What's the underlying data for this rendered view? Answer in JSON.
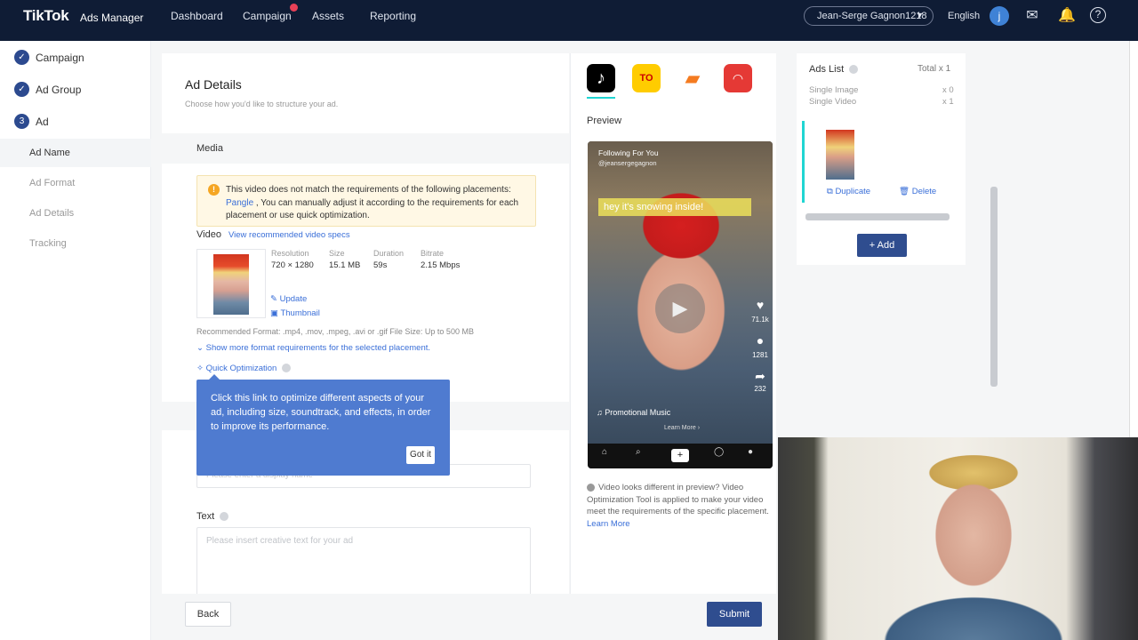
{
  "topbar": {
    "brand": "TikTok",
    "brand_sub": "Ads Manager",
    "nav": [
      "Dashboard",
      "Campaign",
      "Assets",
      "Reporting"
    ],
    "account": "Jean-Serge Gagnon1218",
    "language": "English",
    "avatar_letter": "j"
  },
  "sidebar": {
    "steps": [
      {
        "label": "Campaign",
        "mark": "✓"
      },
      {
        "label": "Ad Group",
        "mark": "✓"
      },
      {
        "label": "Ad",
        "mark": "3"
      }
    ],
    "substeps": [
      "Ad Name",
      "Ad Format",
      "Ad Details",
      "Tracking"
    ]
  },
  "ad_details": {
    "title": "Ad Details",
    "subtitle": "Choose how you'd like to structure your ad.",
    "media_section": "Media",
    "warning_pre": "This video does not match the requirements of the following placements: ",
    "warning_link": "Pangle",
    "warning_post": " , You can manually adjust it according to the requirements for each placement or use quick optimization.",
    "video_label": "Video",
    "video_specs_link": "View recommended video specs",
    "meta": {
      "resolution_h": "Resolution",
      "resolution": "720 × 1280",
      "size_h": "Size",
      "size": "15.1 MB",
      "duration_h": "Duration",
      "duration": "59s",
      "bitrate_h": "Bitrate",
      "bitrate": "2.15 Mbps"
    },
    "update": "Update",
    "thumbnail": "Thumbnail",
    "recommended_format": "Recommended Format: .mp4, .mov, .mpeg, .avi or .gif  File Size: Up to 500 MB",
    "show_more": "Show more format requirements for the selected placement.",
    "quick_opt": "Quick Optimization",
    "display_name_placeholder": "Please enter a display name",
    "text_label": "Text",
    "text_placeholder": "Please insert creative text for your ad"
  },
  "tooltip": {
    "text": "Click this link to optimize different aspects of your ad, including size, soundtrack, and effects, in order to improve its performance.",
    "button": "Got it"
  },
  "preview": {
    "label": "Preview",
    "topbar": "Following  For You",
    "handle": "@jeanserge​gagnon",
    "caption": "hey it's snowing inside!",
    "likes": "71.1k",
    "comments": "1281",
    "shares": "232",
    "music": "Promotional Music",
    "learn_more": "Learn More ›",
    "nav": [
      "Home",
      "Discover",
      "Notifications",
      "Me"
    ],
    "note": "Video looks different in preview? Video Optimization Tool is applied to make your video meet the requirements of the specific placement.",
    "note_link": "Learn More",
    "app_colors": {
      "tiktok": "#000000",
      "buzz": "#ffcc00",
      "babe": "#f47b20",
      "helo": "#e53935"
    }
  },
  "ads_list": {
    "title": "Ads List",
    "total": "Total x 1",
    "rows": [
      {
        "label": "Single Image",
        "count": "x 0"
      },
      {
        "label": "Single Video",
        "count": "x 1"
      }
    ],
    "duplicate": "Duplicate",
    "delete": "Delete",
    "add": "+ Add"
  },
  "footer": {
    "back": "Back",
    "submit": "Submit"
  }
}
